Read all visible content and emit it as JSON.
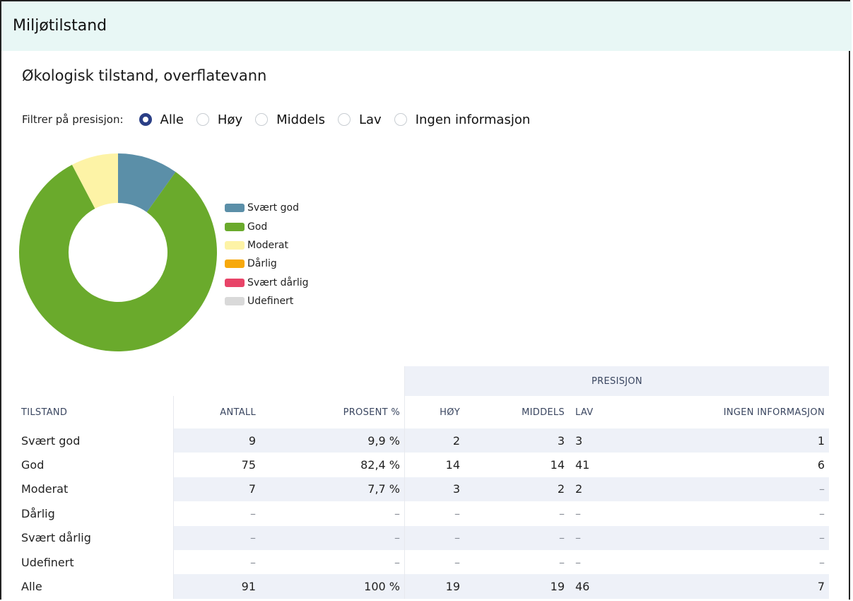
{
  "header": {
    "title": "Miljøtilstand"
  },
  "section": {
    "title": "Økologisk tilstand, overflatevann"
  },
  "filter": {
    "label": "Filtrer på presisjon:",
    "options": [
      {
        "label": "Alle",
        "selected": true
      },
      {
        "label": "Høy",
        "selected": false
      },
      {
        "label": "Middels",
        "selected": false
      },
      {
        "label": "Lav",
        "selected": false
      },
      {
        "label": "Ingen informasjon",
        "selected": false
      }
    ]
  },
  "colors": {
    "svaert_god": "#5b8fa8",
    "god": "#6aaa2c",
    "moderat": "#fdf3a6",
    "darlig": "#f7a90c",
    "svaert_darlig": "#e84468",
    "udefinert": "#d9d9d9"
  },
  "chart_data": {
    "type": "pie",
    "variant": "donut",
    "categories": [
      "Svært god",
      "God",
      "Moderat",
      "Dårlig",
      "Svært dårlig",
      "Udefinert"
    ],
    "values": [
      9,
      75,
      7,
      0,
      0,
      0
    ],
    "colors": [
      "#5b8fa8",
      "#6aaa2c",
      "#fdf3a6",
      "#f7a90c",
      "#e84468",
      "#d9d9d9"
    ],
    "legend_position": "right"
  },
  "table": {
    "group_header": "PRESISJON",
    "headers": {
      "tilstand": "TILSTAND",
      "antall": "ANTALL",
      "prosent": "PROSENT %",
      "hoy": "HØY",
      "middels": "MIDDELS",
      "lav": "LAV",
      "ingen": "INGEN INFORMASJON"
    },
    "rows": [
      {
        "tilstand": "Svært god",
        "antall": "9",
        "prosent": "9,9 %",
        "hoy": "2",
        "middels": "3",
        "lav": "3",
        "ingen": "1"
      },
      {
        "tilstand": "God",
        "antall": "75",
        "prosent": "82,4 %",
        "hoy": "14",
        "middels": "14",
        "lav": "41",
        "ingen": "6"
      },
      {
        "tilstand": "Moderat",
        "antall": "7",
        "prosent": "7,7 %",
        "hoy": "3",
        "middels": "2",
        "lav": "2",
        "ingen": "–"
      },
      {
        "tilstand": "Dårlig",
        "antall": "–",
        "prosent": "–",
        "hoy": "–",
        "middels": "–",
        "lav": "–",
        "ingen": "–"
      },
      {
        "tilstand": "Svært dårlig",
        "antall": "–",
        "prosent": "–",
        "hoy": "–",
        "middels": "–",
        "lav": "–",
        "ingen": "–"
      },
      {
        "tilstand": "Udefinert",
        "antall": "–",
        "prosent": "–",
        "hoy": "–",
        "middels": "–",
        "lav": "–",
        "ingen": "–"
      },
      {
        "tilstand": "Alle",
        "antall": "91",
        "prosent": "100 %",
        "hoy": "19",
        "middels": "19",
        "lav": "46",
        "ingen": "7"
      }
    ]
  }
}
